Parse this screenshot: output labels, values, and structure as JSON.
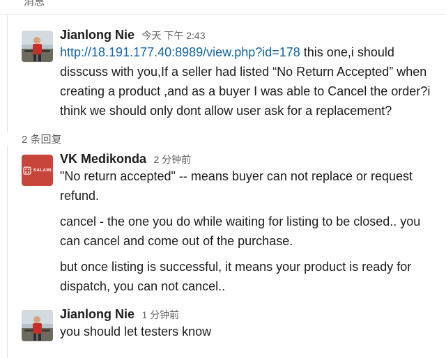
{
  "topbar": {
    "title": "消息"
  },
  "replies_label": "2 条回复",
  "messages": [
    {
      "author": "Jianlong Nie",
      "time": "今天 下午 2:43",
      "link": "http://18.191.177.40:8989/view.php?id=178",
      "text": " this one,i should disscuss with you,If a seller had listed “No Return Accepted” when creating a product ,and as a buyer I was able to Cancel the order?i think we should only dont allow user ask for a replacement?"
    },
    {
      "author": "VK Medikonda",
      "time": "2 分钟前",
      "avatar_text": "SALAMI",
      "paragraphs": [
        "\"No return accepted\" -- means buyer can not replace or request refund.",
        "cancel - the one you do while waiting for listing to be closed.. you can cancel and come out of the purchase.",
        "but once listing is successful, it means your product is ready for dispatch, you can not cancel.."
      ]
    },
    {
      "author": "Jianlong Nie",
      "time": "1 分钟前",
      "text": "you should let testers know"
    }
  ]
}
